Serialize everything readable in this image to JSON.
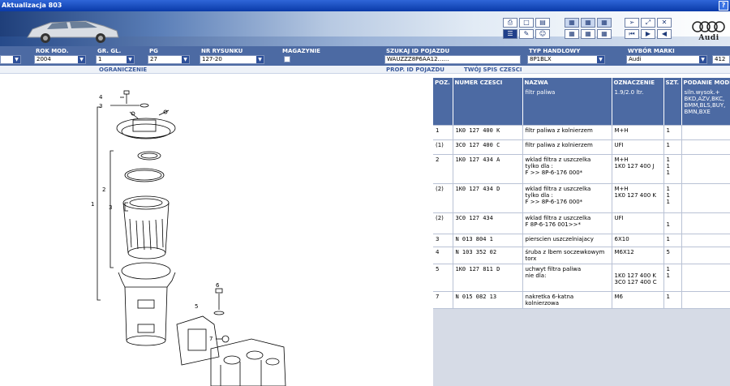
{
  "window": {
    "title": "Aktualizacja 803",
    "help": "?"
  },
  "brand": {
    "logo_text": "Audi"
  },
  "colors": {
    "header_blue": "#4c6aa3",
    "title_blue": "#0a3aa8"
  },
  "filters": {
    "rok_mod": {
      "label": "ROK MOD.",
      "value": "2004"
    },
    "gr_gl": {
      "label": "GR. GL.",
      "value": "1"
    },
    "pg": {
      "label": "PG",
      "value": "27"
    },
    "nr_rysunku": {
      "label": "NR RYSUNKU",
      "value": "127-20"
    },
    "magazynie": {
      "label": "MAGAZYNIE"
    },
    "szukaj": {
      "label": "SZUKAJ ID POJAZDU",
      "value": "WAUZZZ8P6AA12……"
    },
    "typ": {
      "label": "TYP HANDLOWY",
      "value": "8P1BLX"
    },
    "marka": {
      "label": "WYBÓR MARKI",
      "value": "Audi"
    },
    "count": "412"
  },
  "subbar": {
    "ograniczenie": "OGRANICZENIE",
    "prop": "PROP. ID POJAZDU",
    "twoj": "TWÓJ SPIS CZESCI"
  },
  "table": {
    "headers": [
      "POZ.",
      "NUMER CZESCI",
      "NAZWA",
      "OZNACZENIE",
      "SZT.",
      "PODANIE MODELU"
    ],
    "subheader": {
      "nazwa": "filtr paliwa",
      "oznaczenie": "1.9/2.0 ltr.",
      "model": "siln.wysok.+\nBKD,AZV,BKC,\nBMM,BLS,BUY,\nBMN,BXE"
    },
    "rows": [
      {
        "poz": "1",
        "nr": "1K0  127  400  K",
        "nazwa": "filtr paliwa z kolnierzem",
        "ozn": "M+H",
        "szt": "1"
      },
      {
        "poz": "(1)",
        "nr": "3C0  127  400  C",
        "nazwa": "filtr paliwa z kolnierzem",
        "ozn": "UFI",
        "szt": "1"
      },
      {
        "poz": "2",
        "nr": "1K0  127  434  A",
        "nazwa": "wklad filtra z uszczelka\n                tylko  dla :\nF             >> 8P-6-176 000*",
        "ozn": "M+H\n1K0 127 400 J",
        "szt": "1\n1\n1"
      },
      {
        "poz": "(2)",
        "nr": "1K0  127  434  D",
        "nazwa": "wklad filtra z uszczelka\n                tylko  dla :\nF             >> 8P-6-176 000*",
        "ozn": "M+H\n1K0 127 400 K",
        "szt": "1\n1\n1"
      },
      {
        "poz": "(2)",
        "nr": "3C0  127  434",
        "nazwa": "wklad filtra z uszczelka\nF 8P-6-176 001>>*",
        "ozn": "UFI",
        "szt": "\n1"
      },
      {
        "poz": "3",
        "nr": "N    013  804  1",
        "nazwa": "pierscien uszczelniajacy",
        "ozn": "6X10",
        "szt": "1"
      },
      {
        "poz": "4",
        "nr": "N    103  352  02",
        "nazwa": "śruba z lbem soczewkowym torx",
        "ozn": "M6X12",
        "szt": "5"
      },
      {
        "poz": "5",
        "nr": "1K0  127  811  D",
        "nazwa": "uchwyt filtra paliwa\n                       nie dla:",
        "ozn": "\n1K0 127 400 K\n3C0 127 400 C",
        "szt": "1\n1"
      },
      {
        "poz": "7",
        "nr": "N    015  082  13",
        "nazwa": "nakretka 6-katna kolnierzowa",
        "ozn": "M6",
        "szt": "1"
      }
    ]
  },
  "diagram": {
    "callouts": [
      "1",
      "2",
      "3",
      "3",
      "4",
      "5",
      "6",
      "7"
    ]
  }
}
